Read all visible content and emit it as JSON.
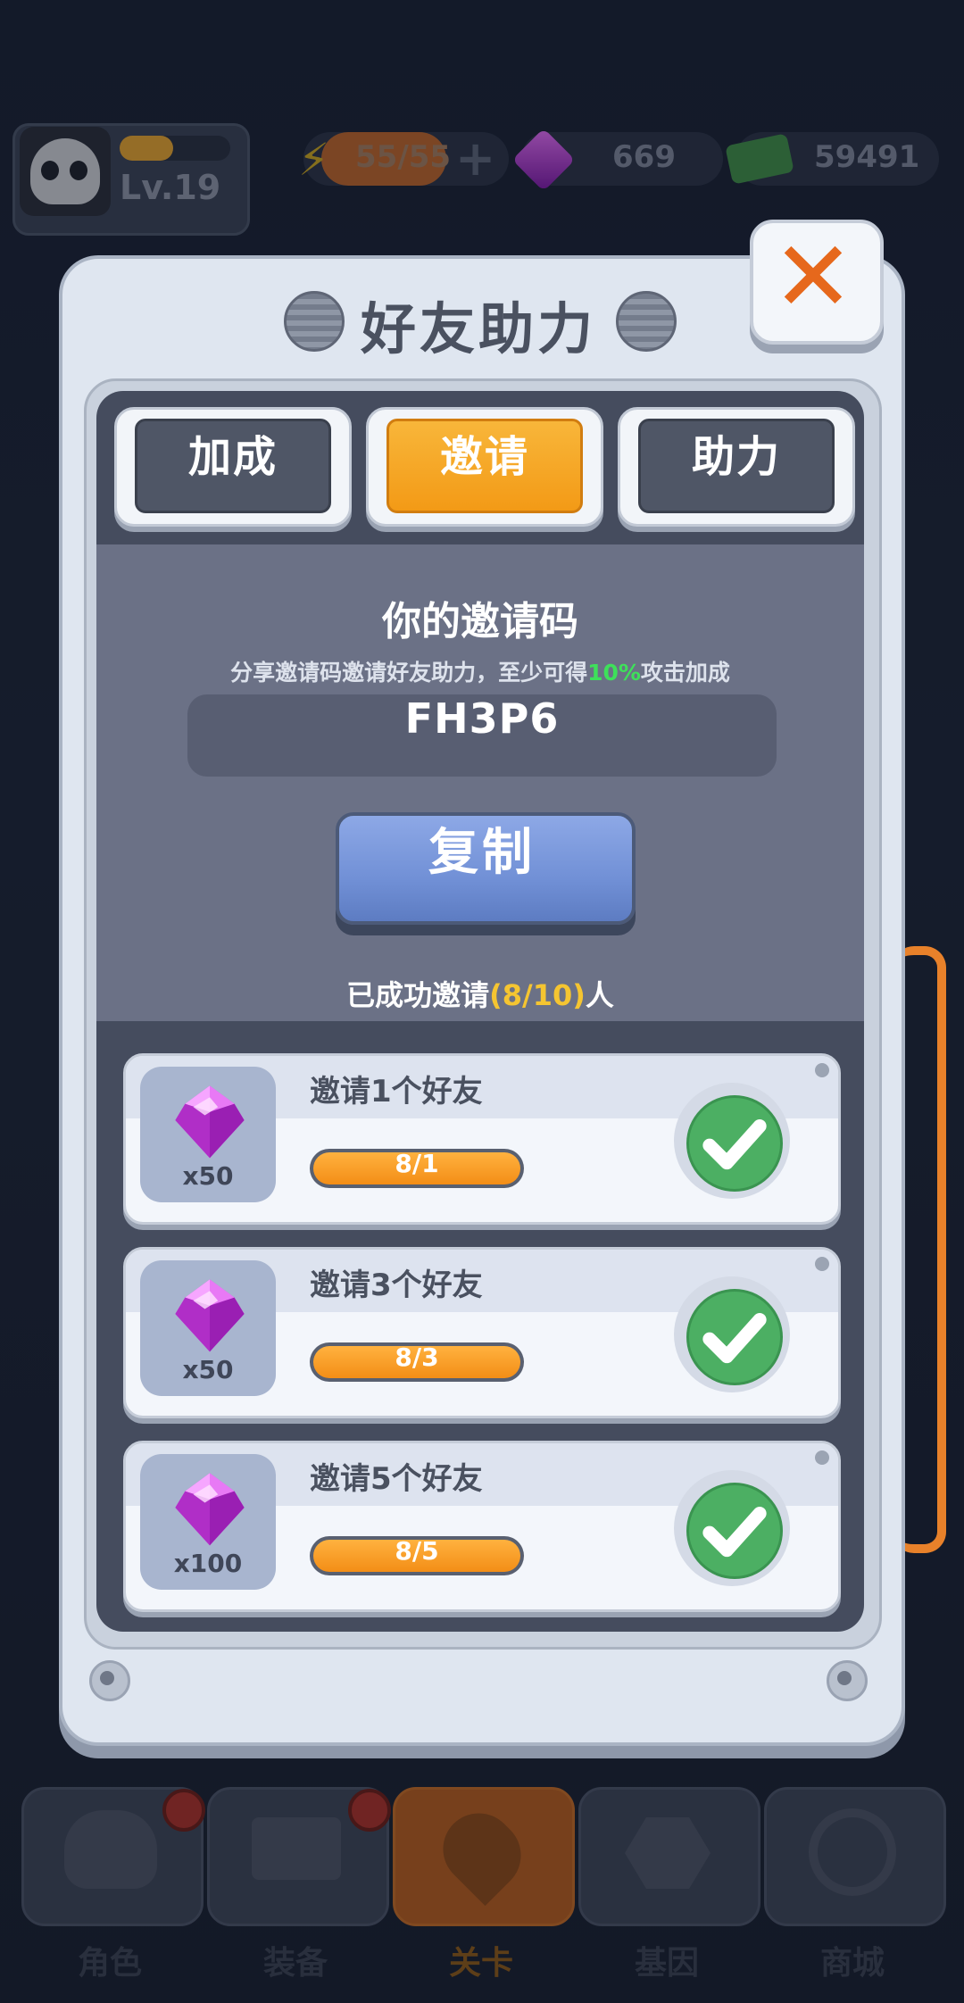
{
  "hud": {
    "level": "Lv.19",
    "energy": "55/55",
    "gems": "669",
    "cash": "59491",
    "level_progress": 0.45
  },
  "modal": {
    "title": "好友助力",
    "close_icon": "close-icon"
  },
  "tabs": [
    {
      "label": "加成",
      "active": false
    },
    {
      "label": "邀请",
      "active": true
    },
    {
      "label": "助力",
      "active": false
    }
  ],
  "invite": {
    "heading": "你的邀请码",
    "desc_prefix": "分享邀请码邀请好友助力，至少可得",
    "desc_highlight": "10%",
    "desc_suffix": "攻击加成",
    "code": "FH3P6",
    "copy_label": "复制",
    "success_prefix": "已成功邀请",
    "success_count": "(8/10)",
    "success_suffix": "人"
  },
  "rewards": [
    {
      "title": "邀请1个好友",
      "qty": "x50",
      "progress": "8/1",
      "fill": 1.0,
      "icon": "gem-icon",
      "claimed": true
    },
    {
      "title": "邀请3个好友",
      "qty": "x50",
      "progress": "8/3",
      "fill": 1.0,
      "icon": "gem-icon",
      "claimed": true
    },
    {
      "title": "邀请5个好友",
      "qty": "x100",
      "progress": "8/5",
      "fill": 1.0,
      "icon": "gem-icon",
      "claimed": true
    }
  ],
  "bottom_nav": [
    {
      "label": "角色",
      "icon": "skull-icon",
      "badge": true,
      "active": false
    },
    {
      "label": "装备",
      "icon": "gun-icon",
      "badge": true,
      "active": false
    },
    {
      "label": "关卡",
      "icon": "map-pin-icon",
      "badge": false,
      "active": true
    },
    {
      "label": "基因",
      "icon": "hexagon-icon",
      "badge": false,
      "active": false
    },
    {
      "label": "商城",
      "icon": "shop-icon",
      "badge": false,
      "active": false
    }
  ],
  "colors": {
    "accent_orange": "#f39a16",
    "highlight_green": "#3ee05a",
    "highlight_yellow": "#f5c531",
    "check_green": "#4caf63",
    "gem_pink": "#e06ef2"
  }
}
